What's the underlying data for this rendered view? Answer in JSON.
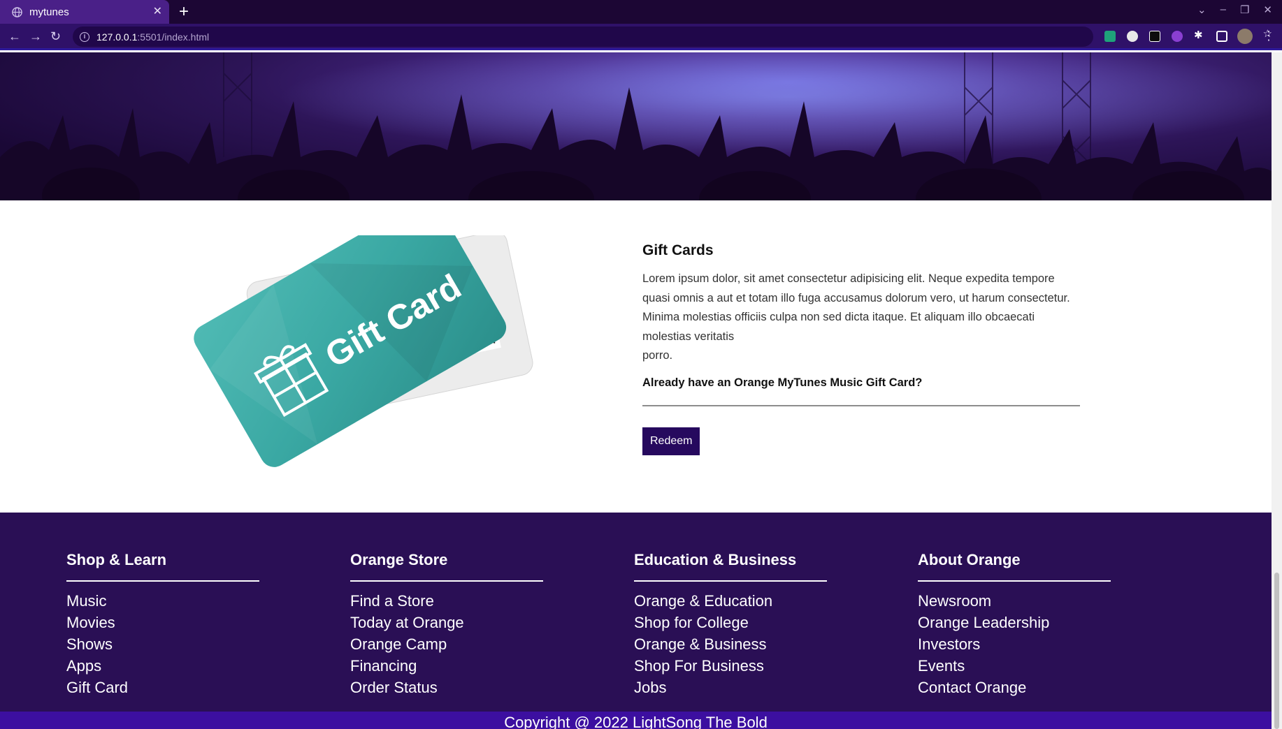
{
  "browser": {
    "tab_title": "mytunes",
    "tab_close": "✕",
    "new_tab": "+",
    "url_host": "127.0.0.1",
    "url_path": ":5501/index.html",
    "controls": [
      "⌄",
      "–",
      "❐",
      "✕"
    ]
  },
  "gift": {
    "card_text": "Gift Card",
    "title": "Gift Cards",
    "body": "Lorem ipsum dolor, sit amet consectetur adipisicing elit. Neque expedita tempore quasi omnis a aut et totam illo fuga accusamus dolorum vero, ut harum consectetur. Minima molestias officiis culpa non sed dicta itaque. Et aliquam illo obcaecati molestias veritatis",
    "body_tail": "porro.",
    "prompt": "Already have an Orange MyTunes Music Gift Card?",
    "redeem_label": "Redeem"
  },
  "footer": {
    "columns": [
      {
        "title": "Shop & Learn",
        "links": [
          "Music",
          "Movies",
          "Shows",
          "Apps",
          "Gift Card"
        ]
      },
      {
        "title": "Orange Store",
        "links": [
          "Find a Store",
          "Today at Orange",
          "Orange Camp",
          "Financing",
          "Order Status"
        ]
      },
      {
        "title": "Education & Business",
        "links": [
          "Orange & Education",
          "Shop for College",
          "Orange & Business",
          "Shop For Business",
          "Jobs"
        ]
      },
      {
        "title": "About Orange",
        "links": [
          "Newsroom",
          "Orange Leadership",
          "Investors",
          "Events",
          "Contact Orange"
        ]
      }
    ],
    "copyright": "Copyright @ 2022 LightSong The Bold"
  },
  "colors": {
    "footer_bg": "#2a0f55",
    "button_bg": "#26095e",
    "tab_bg": "#4a2088",
    "hero_purple": "#4a2a8c",
    "card_teal": "#3aa8a3"
  }
}
